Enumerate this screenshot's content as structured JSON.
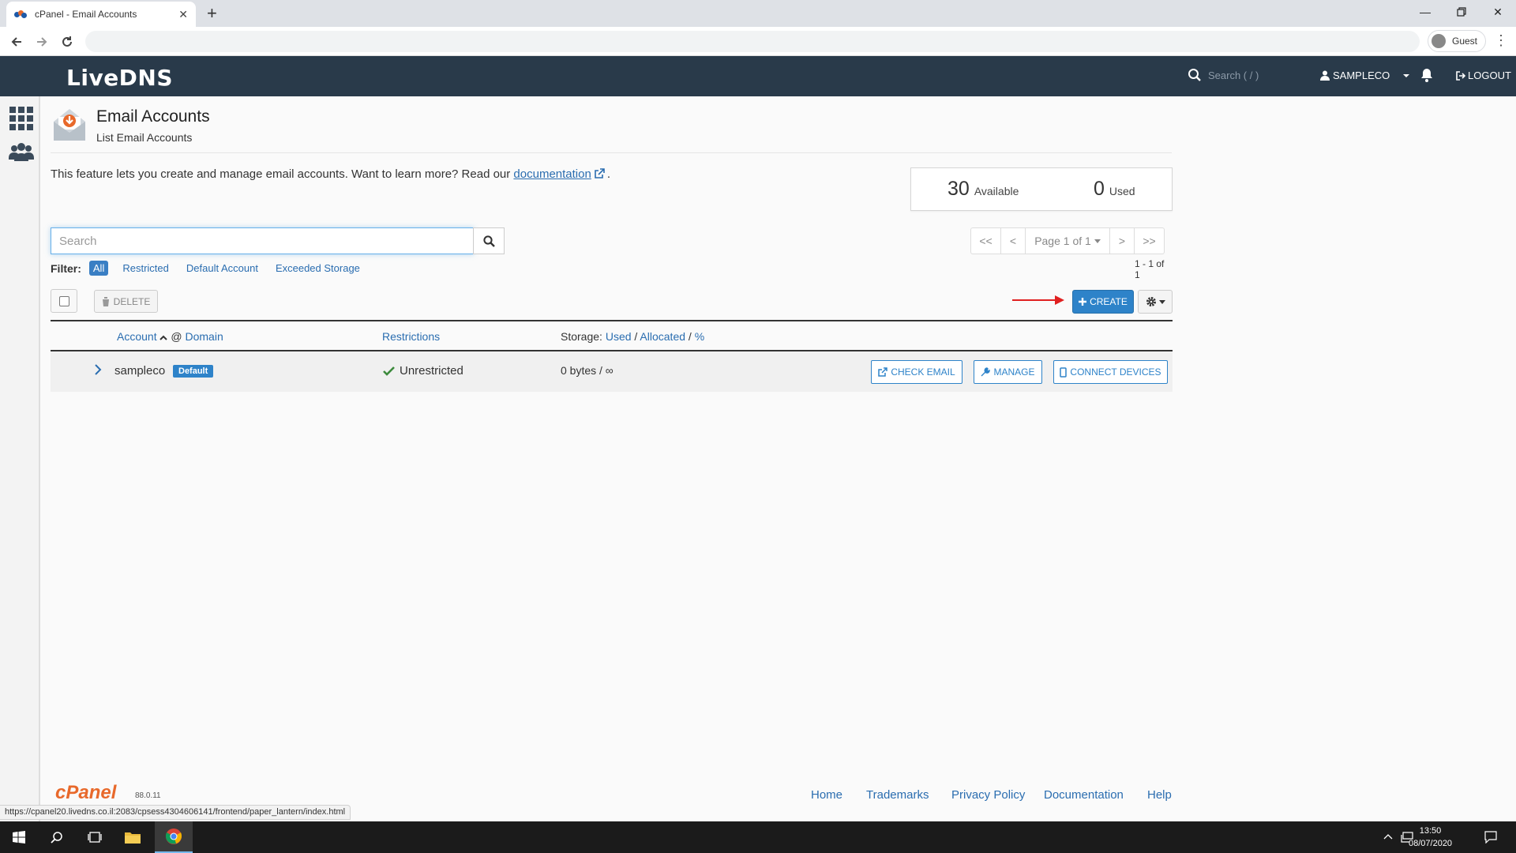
{
  "browser": {
    "tab_title": "cPanel - Email Accounts",
    "profile_label": "Guest"
  },
  "header": {
    "logo": "LiveDNS",
    "search_placeholder": "Search ( / )",
    "user": "SAMPLECO",
    "logout": "LOGOUT"
  },
  "page": {
    "title": "Email Accounts",
    "subtitle": "List Email Accounts",
    "intro_text": "This feature lets you create and manage email accounts. Want to learn more? Read our ",
    "intro_link": "documentation",
    "intro_end": "."
  },
  "stats": {
    "available_value": "30",
    "available_label": "Available",
    "used_value": "0",
    "used_label": "Used"
  },
  "search": {
    "placeholder": "Search"
  },
  "filter": {
    "label": "Filter:",
    "options": [
      "All",
      "Restricted",
      "Default Account",
      "Exceeded Storage"
    ],
    "active": "All"
  },
  "pager": {
    "first": "<<",
    "prev": "<",
    "page_label": "Page 1 of 1",
    "next": ">",
    "last": ">>",
    "range": "1 - 1 of 1"
  },
  "actions": {
    "delete": "DELETE",
    "create": "CREATE"
  },
  "table": {
    "col_account": "Account",
    "col_at": "@",
    "col_domain": "Domain",
    "col_restrictions": "Restrictions",
    "col_storage": "Storage:",
    "col_used": "Used",
    "col_allocated": "Allocated",
    "col_percent": "%",
    "sep": "/",
    "rows": [
      {
        "account": "sampleco",
        "badge": "Default",
        "restriction": "Unrestricted",
        "storage": "0 bytes / ∞",
        "btn_check": "CHECK EMAIL",
        "btn_manage": "MANAGE",
        "btn_connect": "CONNECT DEVICES"
      }
    ]
  },
  "footer": {
    "cpanel_logo": "cPanel",
    "version": "88.0.11",
    "links": [
      "Home",
      "Trademarks",
      "Privacy Policy",
      "Documentation",
      "Help"
    ]
  },
  "status_url": "https://cpanel20.livedns.co.il:2083/cpsess4304606141/frontend/paper_lantern/index.html",
  "taskbar": {
    "time": "13:50",
    "date": "08/07/2020"
  },
  "colors": {
    "header_bg": "#293a4a",
    "accent": "#2e83c9",
    "link": "#2a6db0",
    "arrow": "#e02020",
    "cpanel_orange": "#e8692b"
  }
}
